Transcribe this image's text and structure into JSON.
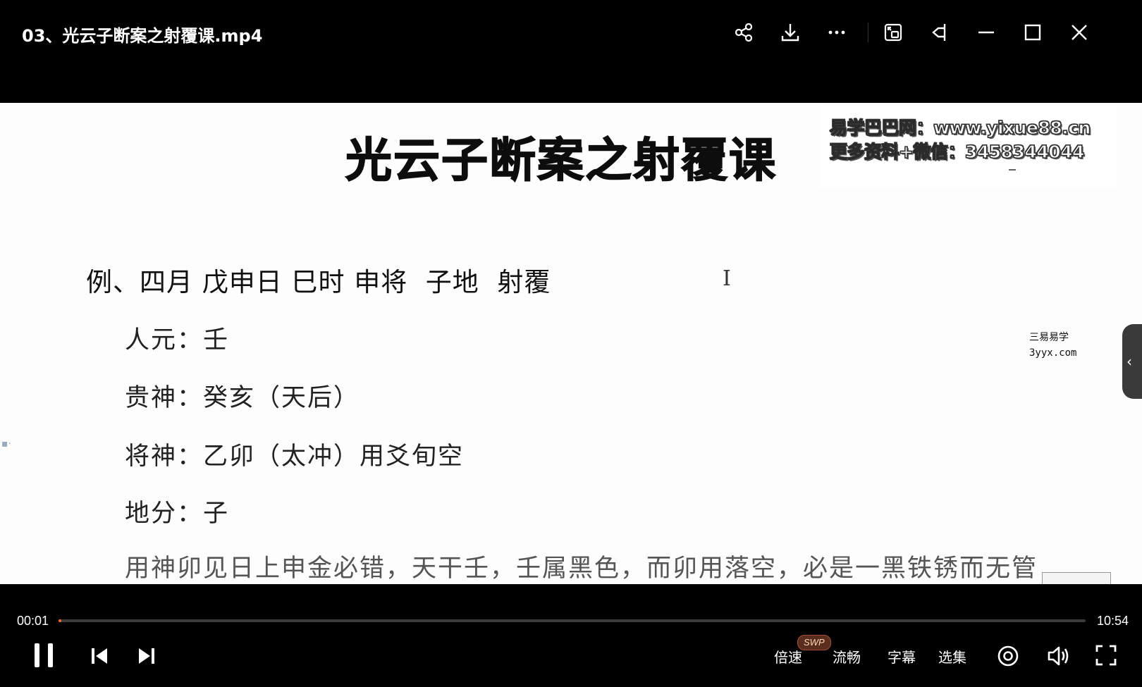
{
  "window": {
    "title": "03、光云子断案之射覆课.mp4",
    "actions": [
      {
        "name": "share-icon"
      },
      {
        "name": "download-icon"
      },
      {
        "name": "more-icon"
      },
      {
        "name": "picture-in-picture-icon"
      },
      {
        "name": "pin-top-icon"
      },
      {
        "name": "minimize-icon"
      },
      {
        "name": "maximize-icon"
      },
      {
        "name": "close-icon"
      }
    ]
  },
  "slide": {
    "title": "光云子断案之射覆课",
    "ghost": "",
    "watermark_line1": "易学巴巴网：www.yixue88.cn",
    "watermark_line2": "更多资料+微信：3458344044",
    "example": "例、四月 戊申日 巳时 申将  子地  射覆",
    "cursor": "I",
    "rows": [
      "人元：壬",
      "贵神：癸亥（天后）",
      "将神：乙卯（太冲）用爻旬空",
      "地分：子"
    ],
    "cut_line": "用神卯见日上申金必错，天干壬，壬属黑色，而卯用落空，必是一黑铁锈而无管",
    "site_mark_line1": "三易易学",
    "site_mark_line2": "3yyx.com"
  },
  "player": {
    "current_time": "00:01",
    "duration": "10:54",
    "progress": 0.0015,
    "speed_label": "倍速",
    "speed_badge": "SWP",
    "quality_label": "流畅",
    "subtitle_label": "字幕",
    "episode_label": "选集",
    "accent_color": "#ff6a1a"
  }
}
